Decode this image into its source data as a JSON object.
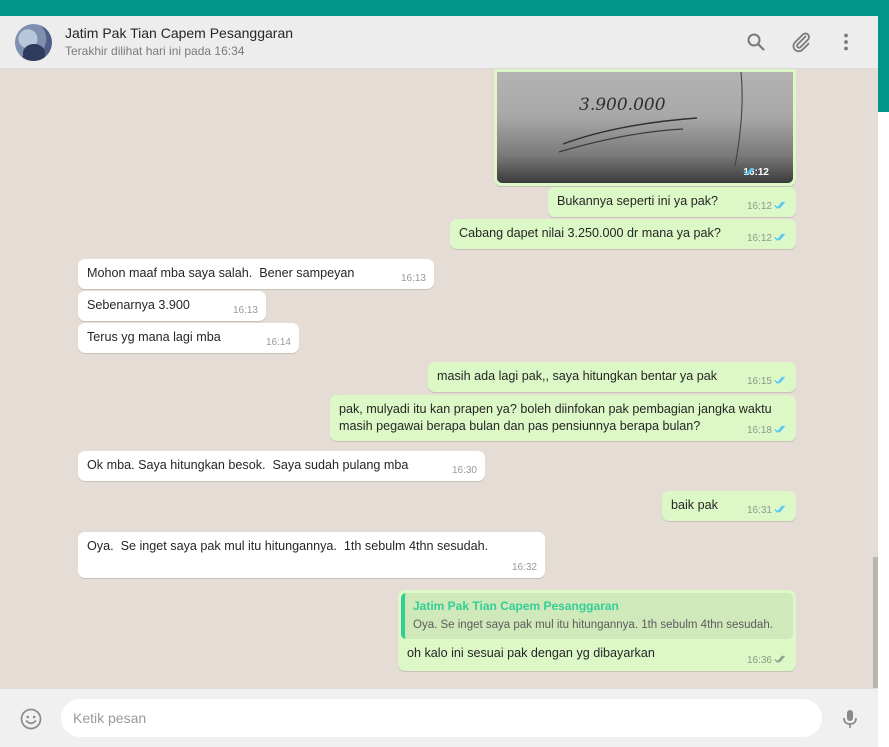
{
  "header": {
    "contact_name": "Jatim Pak Tian Capem Pesanggaran",
    "status": "Terakhir dilihat hari ini pada 16:34",
    "icons": [
      "search-icon",
      "attach-icon",
      "menu-icon"
    ]
  },
  "image_message": {
    "handwriting": "3.900.000",
    "time": "16:12"
  },
  "messages": [
    {
      "dir": "out",
      "text": "Bukannya seperti ini ya pak?",
      "time": "16:12"
    },
    {
      "dir": "out",
      "text": "Cabang dapet nilai 3.250.000 dr mana ya pak?",
      "time": "16:12"
    },
    {
      "dir": "in",
      "text": "Mohon maaf mba saya salah.  Bener sampeyan",
      "time": "16:13"
    },
    {
      "dir": "in",
      "text": "Sebenarnya 3.900",
      "time": "16:13"
    },
    {
      "dir": "in",
      "text": "Terus yg mana lagi mba",
      "time": "16:14"
    },
    {
      "dir": "out",
      "text": "masih ada lagi pak,, saya hitungkan bentar ya pak",
      "time": "16:15"
    },
    {
      "dir": "out",
      "text": "pak, mulyadi itu kan prapen ya? boleh diinfokan pak pembagian jangka waktu masih pegawai berapa bulan dan pas pensiunnya berapa bulan?",
      "time": "16:18"
    },
    {
      "dir": "in",
      "text": "Ok mba. Saya hitungkan besok.  Saya sudah pulang mba",
      "time": "16:30"
    },
    {
      "dir": "out",
      "text": "baik pak",
      "time": "16:31"
    },
    {
      "dir": "in",
      "text": "Oya.  Se inget saya pak mul itu hitungannya.  1th sebulm 4thn sesudah.",
      "time": "16:32"
    },
    {
      "dir": "out",
      "quote_name": "Jatim Pak Tian Capem Pesanggaran",
      "quote_text": "Oya. Se inget saya pak mul itu hitungannya. 1th sebulm 4thn sesudah.",
      "text": "oh kalo ini sesuai pak dengan yg dibayarkan",
      "time": "16:36"
    }
  ],
  "composer": {
    "placeholder": "Ketik pesan"
  },
  "colors": {
    "accent": "#009688",
    "chat_bg": "#e5ddd5",
    "outgoing": "#dcf8c6",
    "incoming": "#ffffff",
    "read_ticks": "#4fc3f7",
    "quote_accent": "#35cd96"
  }
}
